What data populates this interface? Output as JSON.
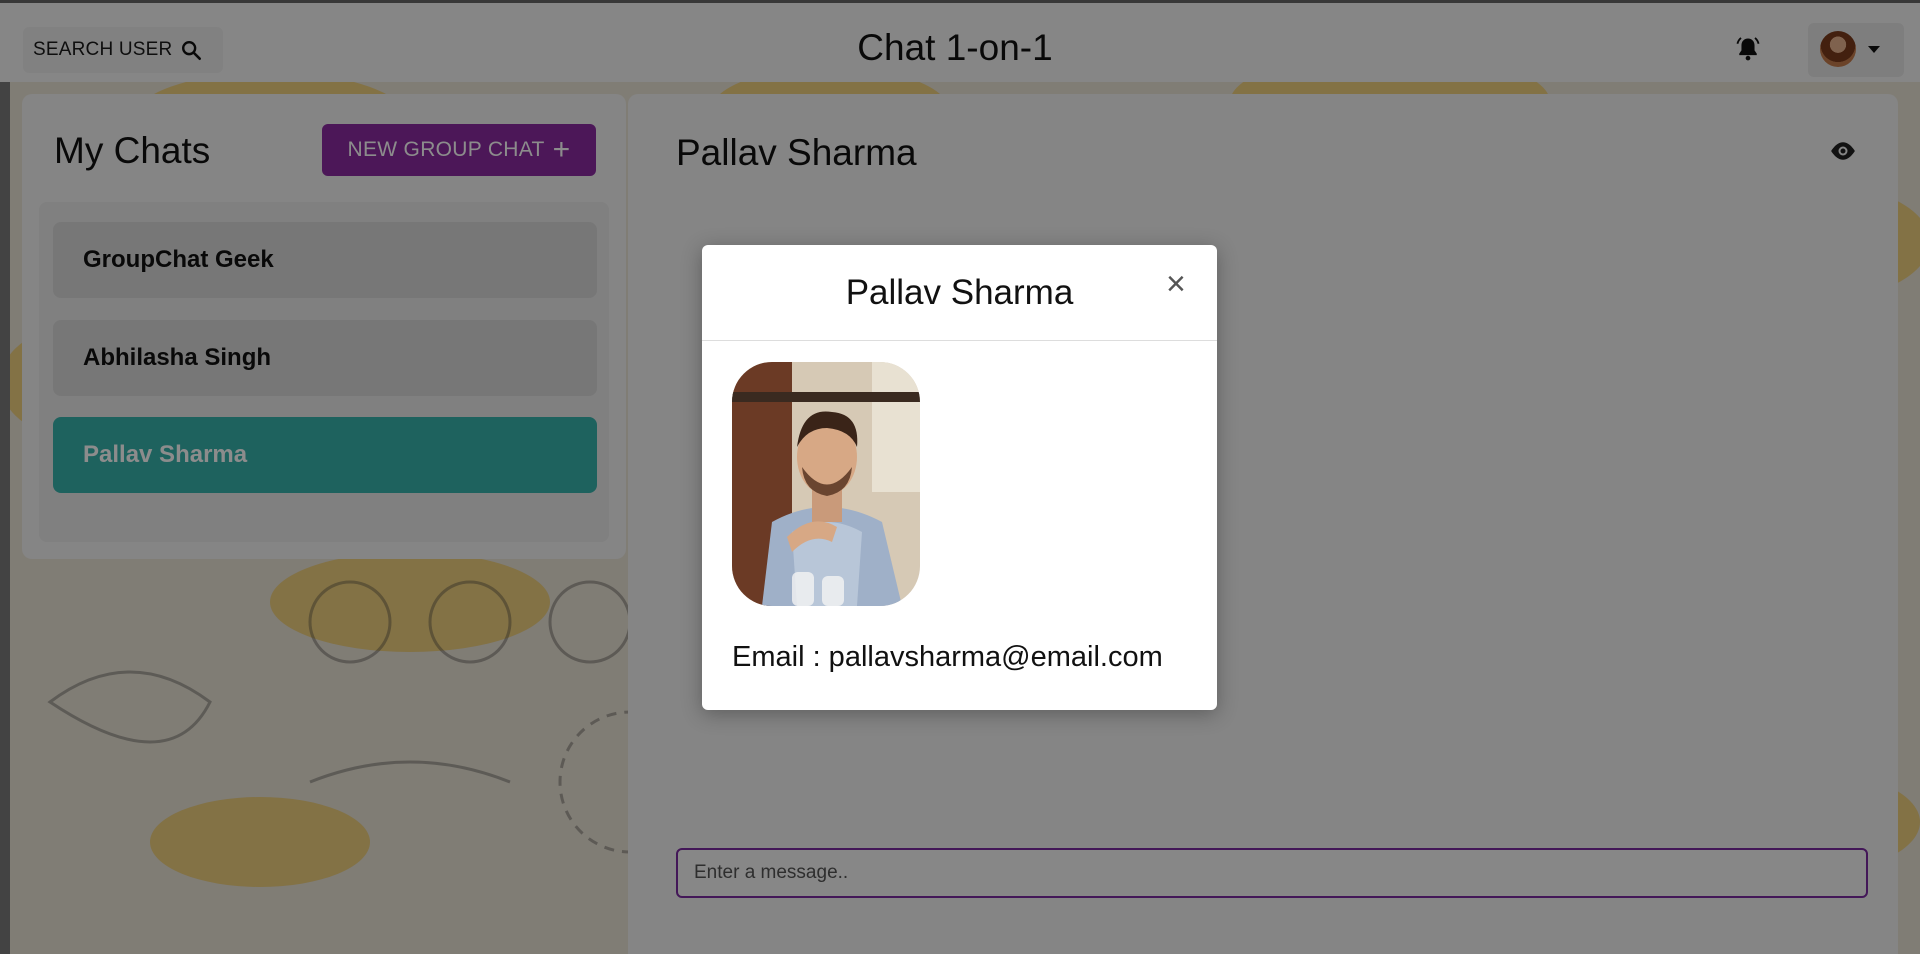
{
  "topbar": {
    "search_label": "SEARCH USER",
    "search_icon": "search-icon",
    "app_title": "Chat 1-on-1",
    "bell_icon": "bell-icon",
    "avatar_icon": "user-avatar"
  },
  "sidebar": {
    "title": "My Chats",
    "new_group_label": "NEW GROUP CHAT",
    "new_group_icon": "+",
    "chats": [
      {
        "label": "GroupChat Geek",
        "active": false
      },
      {
        "label": "Abhilasha Singh",
        "active": false
      },
      {
        "label": "Pallav Sharma",
        "active": true
      }
    ]
  },
  "chat": {
    "name": "Pallav Sharma",
    "view_profile_icon": "eye-icon",
    "input_placeholder": "Enter a message.."
  },
  "modal": {
    "title": "Pallav Sharma",
    "close_icon": "×",
    "email_line": "Email : pallavsharma@email.com"
  },
  "colors": {
    "accent_purple": "#8a2aa0",
    "active_chat": "#38b2ac",
    "input_border": "#7b2aa0"
  }
}
